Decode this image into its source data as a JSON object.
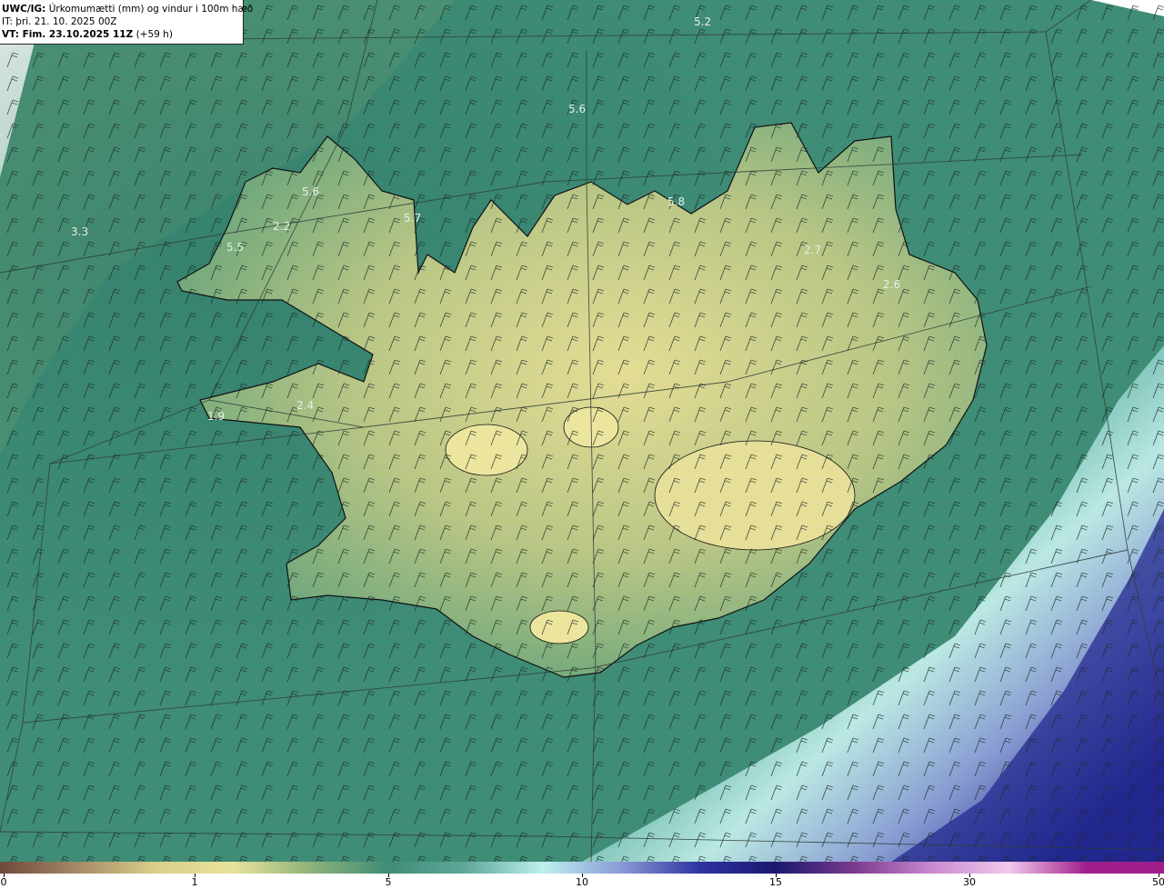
{
  "header": {
    "model_label": "UWC/IG:",
    "product_title": "Úrkomumætti (mm) og vindur i 100m hæð",
    "init_time": "IT: þri. 21. 10. 2025 00Z",
    "valid_label": "VT: Fim. 23.10.2025 11Z",
    "lead_time": "(+59 h)"
  },
  "colors": {
    "ocean": "#3f8c77",
    "land_low": "#6aa57b",
    "land_high": "#e0d98f",
    "coast": "#101010",
    "graticule": "#2f3f38",
    "outside": "#ffffff",
    "front_light": "#b8ecea",
    "front_dark": "#1e238a"
  },
  "colorbar": {
    "labels": [
      "0",
      "1",
      "5",
      "10",
      "15",
      "30",
      "50"
    ],
    "gradient": [
      "#6e4a3c",
      "#a58a67",
      "#d9cf8a",
      "#e8e39b",
      "#8fb27a",
      "#3f8c77",
      "#5fa89a",
      "#bff0ee",
      "#8a9ad6",
      "#2e33a0",
      "#1b1770",
      "#7a3a8c",
      "#c98ad0",
      "#f2c8ec",
      "#a01e8c"
    ]
  },
  "map_values": [
    {
      "text": "5.2"
    },
    {
      "text": "5.6"
    },
    {
      "text": "5.6"
    },
    {
      "text": "5.7"
    },
    {
      "text": "5.8"
    },
    {
      "text": "3.3"
    },
    {
      "text": "5.5"
    },
    {
      "text": "2.2"
    },
    {
      "text": "2.7"
    },
    {
      "text": "2.6"
    },
    {
      "text": "2.4"
    },
    {
      "text": "1.9"
    }
  ]
}
